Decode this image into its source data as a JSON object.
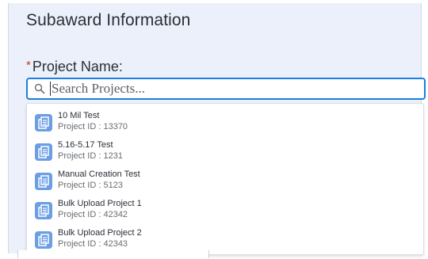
{
  "section": {
    "title": "Subaward Information"
  },
  "project_field": {
    "required_mark": "*",
    "label": "Project Name:",
    "placeholder": "Search Projects...",
    "value": ""
  },
  "results": [
    {
      "name": "10 Mil Test",
      "id_text": "Project ID : 13370"
    },
    {
      "name": "5.16-5.17 Test",
      "id_text": "Project ID : 1231"
    },
    {
      "name": "Manual Creation Test",
      "id_text": "Project ID : 5123"
    },
    {
      "name": "Bulk Upload Project 1",
      "id_text": "Project ID : 42342"
    },
    {
      "name": "Bulk Upload Project 2",
      "id_text": "Project ID : 42343"
    }
  ],
  "icons": {
    "search": "search-icon",
    "result": "project-icon"
  },
  "colors": {
    "panel_bg": "#ebf0fa",
    "focus_border": "#1b7fe0",
    "required": "#c23934",
    "result_icon": "#6b9ee4"
  }
}
